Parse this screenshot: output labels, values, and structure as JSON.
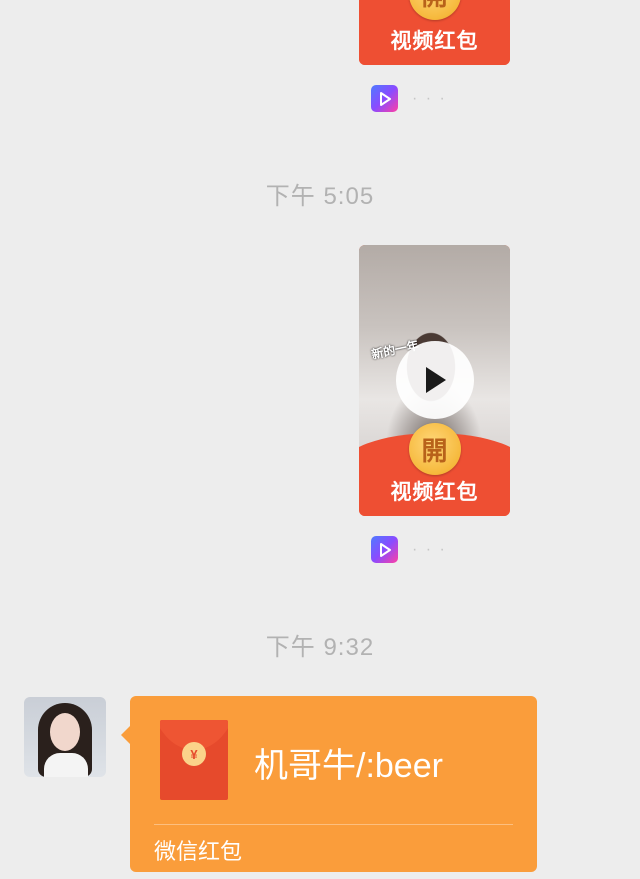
{
  "video_packets": [
    {
      "label": "视频红包",
      "open_glyph": "開",
      "channel_icon": "video-channel-icon",
      "channel_name": "· · ·"
    },
    {
      "label": "视频红包",
      "open_glyph": "開",
      "thumbnail_caption": "新的一年",
      "channel_icon": "video-channel-icon",
      "channel_name": "· · ·"
    }
  ],
  "timestamps": {
    "first": "下午 5:05",
    "second": "下午 9:32"
  },
  "incoming_packet": {
    "sender_avatar": "avatar",
    "coin_glyph": "¥",
    "greeting": "机哥牛/:beer",
    "footer": "微信红包",
    "color": "#fa9d3b"
  },
  "colors": {
    "background": "#ededed",
    "packet_red": "#ee4f33",
    "packet_orange": "#fa9d3b",
    "timestamp_gray": "#b2b2b2"
  }
}
